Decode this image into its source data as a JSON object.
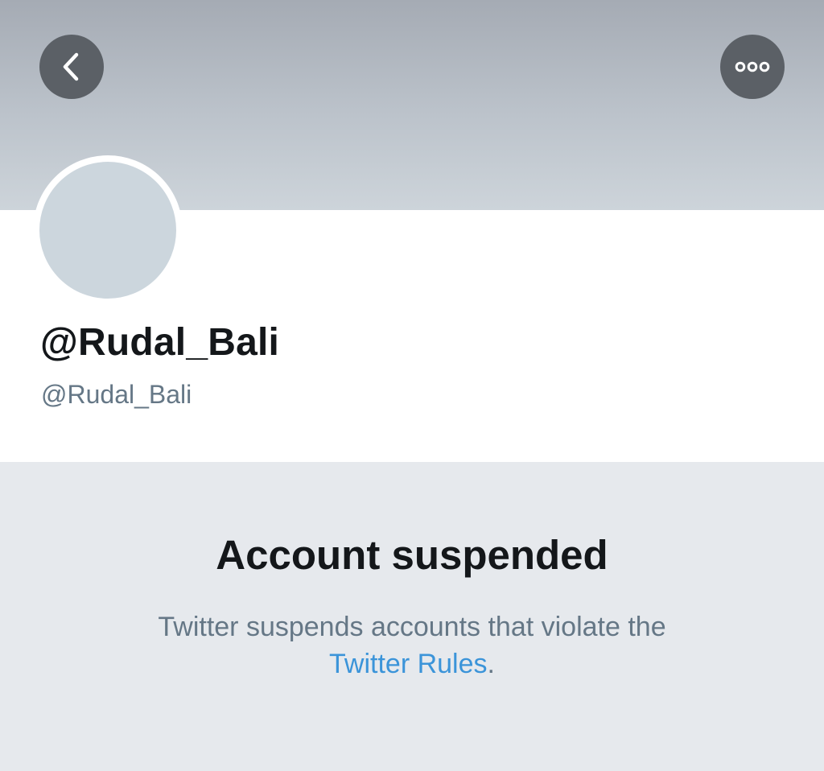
{
  "header": {
    "back_icon": "chevron-left-icon",
    "more_icon": "more-horizontal-icon"
  },
  "profile": {
    "display_name": "@Rudal_Bali",
    "handle": "@Rudal_Bali"
  },
  "suspension": {
    "title": "Account suspended",
    "message": "Twitter suspends accounts that violate the",
    "link_text": "Twitter Rules",
    "trailing": "."
  },
  "colors": {
    "link": "#3b94d9",
    "button_bg": "#5b6066",
    "avatar_placeholder": "#ccd6dd",
    "notice_bg": "#e6e9ed"
  }
}
